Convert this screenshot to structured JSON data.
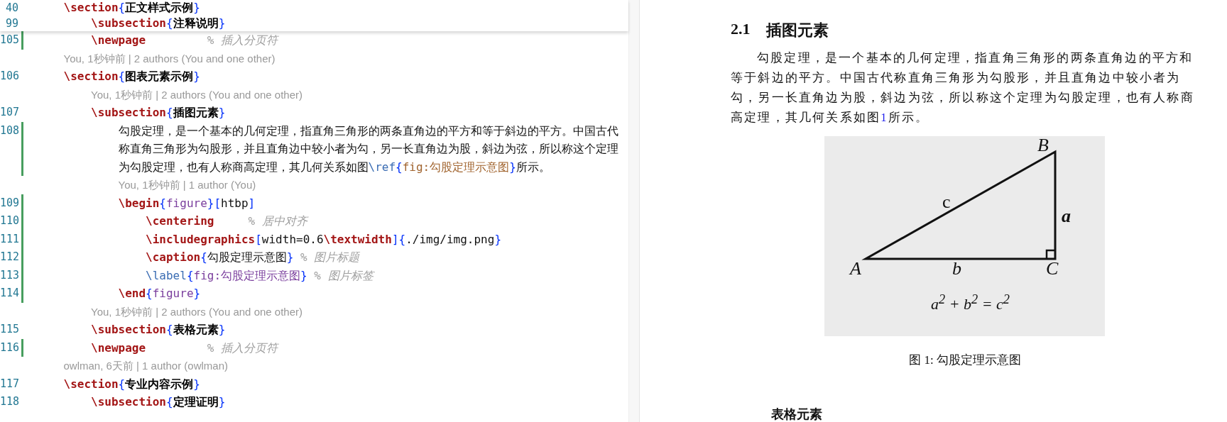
{
  "editor": {
    "sticky_lines": [
      {
        "number": "40",
        "tokens": [
          {
            "kind": "cmd",
            "text": "    \\section"
          },
          {
            "kind": "brace",
            "text": "{"
          },
          {
            "kind": "arg",
            "text": "正文样式示例"
          },
          {
            "kind": "brace",
            "text": "}"
          }
        ]
      },
      {
        "number": "99",
        "tokens": [
          {
            "kind": "cmd",
            "text": "        \\subsection"
          },
          {
            "kind": "brace",
            "text": "{"
          },
          {
            "kind": "arg",
            "text": "注释说明"
          },
          {
            "kind": "brace",
            "text": "}"
          }
        ]
      }
    ],
    "lines": [
      {
        "kind": "code",
        "number": "105",
        "modified": true,
        "tokens": [
          {
            "kind": "cmd",
            "text": "        \\newpage"
          },
          {
            "kind": "comment",
            "text": "         % 插入分页符"
          }
        ]
      },
      {
        "kind": "blame",
        "text": "    You, 1秒钟前 | 2 authors (You and one other)"
      },
      {
        "kind": "code",
        "number": "106",
        "modified": false,
        "tokens": [
          {
            "kind": "cmd",
            "text": "    \\section"
          },
          {
            "kind": "brace",
            "text": "{"
          },
          {
            "kind": "arg",
            "text": "图表元素示例"
          },
          {
            "kind": "brace",
            "text": "}"
          }
        ]
      },
      {
        "kind": "blame",
        "text": "        You, 1秒钟前 | 2 authors (You and one other)"
      },
      {
        "kind": "code",
        "number": "107",
        "modified": false,
        "tokens": [
          {
            "kind": "cmd",
            "text": "        \\subsection"
          },
          {
            "kind": "brace",
            "text": "{"
          },
          {
            "kind": "arg",
            "text": "插图元素"
          },
          {
            "kind": "brace",
            "text": "}"
          }
        ]
      },
      {
        "kind": "code",
        "number": "108",
        "modified": true,
        "tokens": [
          {
            "kind": "text",
            "text": "            勾股定理，是一个基本的几何定理，指直角三角形的两条直角边的平方和等于斜边的平方。中国古代称直角三角形为勾股形，并且直角边中较小者为勾，另一长直角边为股，斜边为弦，所以称这个定理为勾股定理，也有人称商高定理，其几何关系如图"
          },
          {
            "kind": "cmd2",
            "text": "\\ref"
          },
          {
            "kind": "brace",
            "text": "{"
          },
          {
            "kind": "key",
            "text": "fig:勾股定理示意图"
          },
          {
            "kind": "brace",
            "text": "}"
          },
          {
            "kind": "text",
            "text": "所示。"
          }
        ]
      },
      {
        "kind": "blame",
        "text": "            You, 1秒钟前 | 1 author (You)"
      },
      {
        "kind": "code",
        "number": "109",
        "modified": true,
        "tokens": [
          {
            "kind": "cmd",
            "text": "            \\begin"
          },
          {
            "kind": "brace",
            "text": "{"
          },
          {
            "kind": "env",
            "text": "figure"
          },
          {
            "kind": "brace",
            "text": "}"
          },
          {
            "kind": "brace",
            "text": "["
          },
          {
            "kind": "text",
            "text": "htbp"
          },
          {
            "kind": "brace",
            "text": "]"
          }
        ]
      },
      {
        "kind": "code",
        "number": "110",
        "modified": true,
        "tokens": [
          {
            "kind": "cmd",
            "text": "                \\centering"
          },
          {
            "kind": "comment",
            "text": "     % 居中对齐"
          }
        ]
      },
      {
        "kind": "code",
        "number": "111",
        "modified": true,
        "tokens": [
          {
            "kind": "cmd",
            "text": "                \\includegraphics"
          },
          {
            "kind": "brace",
            "text": "["
          },
          {
            "kind": "text",
            "text": "width=0.6"
          },
          {
            "kind": "cmd",
            "text": "\\textwidth"
          },
          {
            "kind": "brace",
            "text": "]{"
          },
          {
            "kind": "text",
            "text": "./img/img.png"
          },
          {
            "kind": "brace",
            "text": "}"
          }
        ]
      },
      {
        "kind": "code",
        "number": "112",
        "modified": true,
        "tokens": [
          {
            "kind": "cmd",
            "text": "                \\caption"
          },
          {
            "kind": "brace",
            "text": "{"
          },
          {
            "kind": "text",
            "text": "勾股定理示意图"
          },
          {
            "kind": "brace",
            "text": "}"
          },
          {
            "kind": "comment",
            "text": " % 图片标题"
          }
        ]
      },
      {
        "kind": "code",
        "number": "113",
        "modified": true,
        "tokens": [
          {
            "kind": "cmd2",
            "text": "                \\label"
          },
          {
            "kind": "brace",
            "text": "{"
          },
          {
            "kind": "label",
            "text": "fig:勾股定理示意图"
          },
          {
            "kind": "brace",
            "text": "}"
          },
          {
            "kind": "comment",
            "text": " % 图片标签"
          }
        ]
      },
      {
        "kind": "code",
        "number": "114",
        "modified": true,
        "tokens": [
          {
            "kind": "cmd",
            "text": "            \\end"
          },
          {
            "kind": "brace",
            "text": "{"
          },
          {
            "kind": "env",
            "text": "figure"
          },
          {
            "kind": "brace",
            "text": "}"
          }
        ]
      },
      {
        "kind": "blame",
        "text": "        You, 1秒钟前 | 2 authors (You and one other)"
      },
      {
        "kind": "code",
        "number": "115",
        "modified": false,
        "tokens": [
          {
            "kind": "cmd",
            "text": "        \\subsection"
          },
          {
            "kind": "brace",
            "text": "{"
          },
          {
            "kind": "arg",
            "text": "表格元素"
          },
          {
            "kind": "brace",
            "text": "}"
          }
        ]
      },
      {
        "kind": "code",
        "number": "116",
        "modified": true,
        "tokens": [
          {
            "kind": "cmd",
            "text": "        \\newpage"
          },
          {
            "kind": "comment",
            "text": "         % 插入分页符"
          }
        ]
      },
      {
        "kind": "blame",
        "text": "    owlman, 6天前 | 1 author (owlman)"
      },
      {
        "kind": "code",
        "number": "117",
        "modified": false,
        "tokens": [
          {
            "kind": "cmd",
            "text": "    \\section"
          },
          {
            "kind": "brace",
            "text": "{"
          },
          {
            "kind": "arg",
            "text": "专业内容示例"
          },
          {
            "kind": "brace",
            "text": "}"
          }
        ]
      },
      {
        "kind": "code",
        "number": "118",
        "modified": false,
        "tokens": [
          {
            "kind": "cmd",
            "text": "        \\subsection"
          },
          {
            "kind": "brace",
            "text": "{"
          },
          {
            "kind": "arg",
            "text": "定理证明"
          },
          {
            "kind": "brace",
            "text": "}"
          }
        ]
      }
    ]
  },
  "preview": {
    "heading": {
      "number": "2.1",
      "title": "插图元素"
    },
    "paragraph": {
      "before": "勾股定理，是一个基本的几何定理，指直角三角形的两条直角边的平方和等于斜边的平方。中国古代称直角三角形为勾股形，并且直角边中较小者为勾，另一长直角边为股，斜边为弦，所以称这个定理为勾股定理，也有人称商高定理，其几何关系如图",
      "ref": "1",
      "after": "所示。"
    },
    "figure": {
      "labels": {
        "A": "A",
        "B": "B",
        "C": "C",
        "a": "a",
        "b": "b",
        "c": "c"
      },
      "formula": "a$^{2}$ + b$^{2}$ = c$^{2}$"
    },
    "caption": "图 1: 勾股定理示意图",
    "next_heading": "表格元素"
  }
}
